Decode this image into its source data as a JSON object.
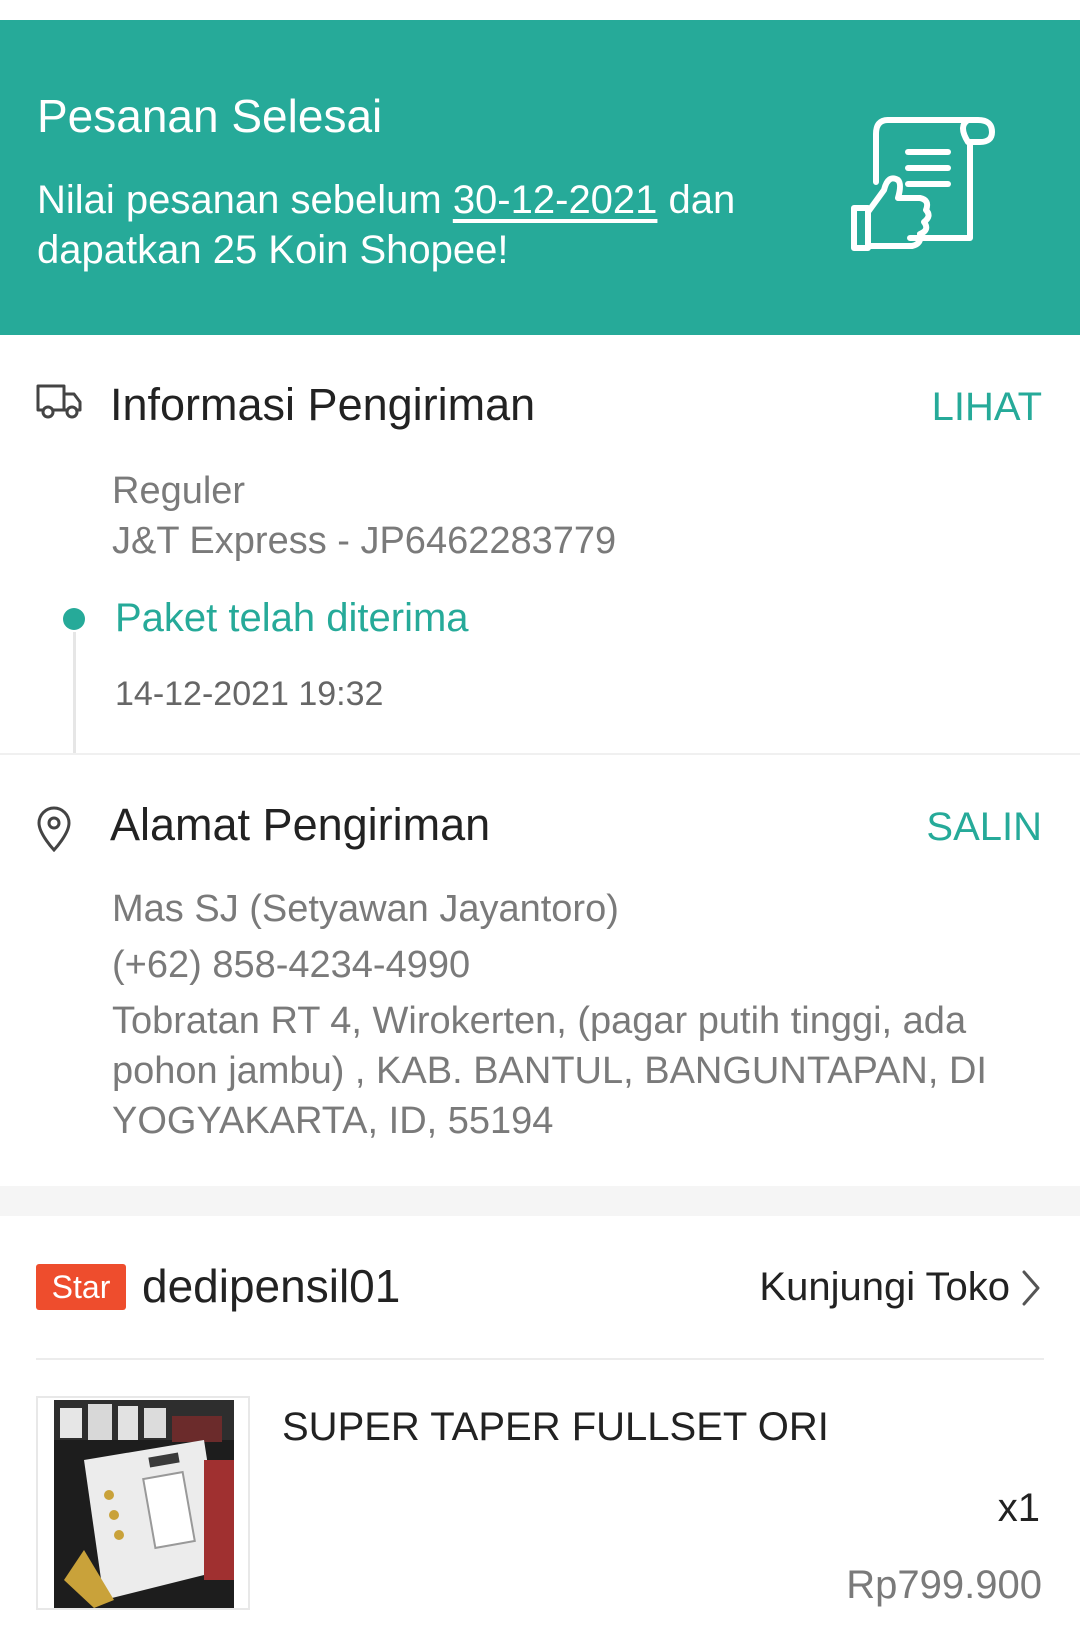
{
  "banner": {
    "title": "Pesanan Selesai",
    "text_before": "Nilai pesanan sebelum ",
    "deadline": "30-12-2021",
    "text_after": " dan dapatkan 25 Koin Shopee!",
    "icon": "receipt-thumbs-up-icon",
    "color": "#26aa99"
  },
  "shipping_info": {
    "title": "Informasi Pengiriman",
    "action": "LIHAT",
    "icon": "truck-icon",
    "service": "Reguler",
    "courier": "J&T Express - JP6462283779",
    "status": "Paket telah diterima",
    "status_time": "14-12-2021 19:32"
  },
  "shipping_address": {
    "title": "Alamat Pengiriman",
    "action": "SALIN",
    "icon": "location-pin-icon",
    "name": "Mas SJ (Setyawan Jayantoro)",
    "phone": "(+62) 858-4234-4990",
    "address": "Tobratan RT 4, Wirokerten, (pagar putih tinggi, ada pohon jambu) , KAB. BANTUL, BANGUNTAPAN, DI YOGYAKARTA, ID, 55194"
  },
  "shop": {
    "badge": "Star",
    "badge_color": "#ee4d2d",
    "name": "dedipensil01",
    "visit_label": "Kunjungi Toko"
  },
  "product": {
    "name": "SUPER TAPER FULLSET ORI",
    "quantity": "x1",
    "price": "Rp799.900"
  }
}
